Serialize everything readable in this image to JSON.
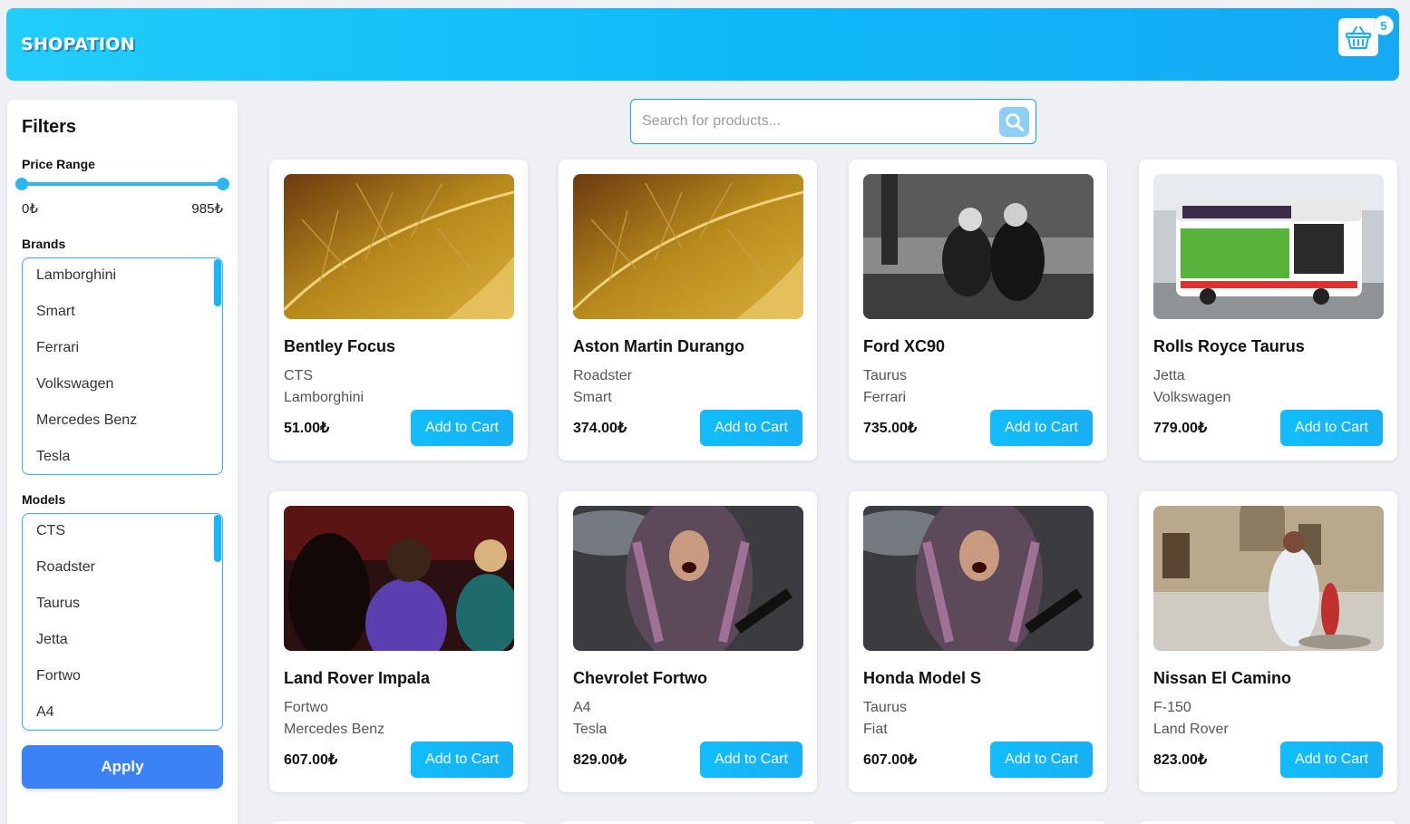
{
  "app": {
    "logo": "SHOPATION"
  },
  "cart": {
    "count": "5",
    "icon": "shopping-basket-icon"
  },
  "search": {
    "placeholder": "Search for products...",
    "icon": "search-icon"
  },
  "sidebar": {
    "title": "Filters",
    "price_range": {
      "label": "Price Range",
      "min_label": "0₺",
      "max_label": "985₺",
      "min": 0,
      "max": 985
    },
    "brands": {
      "label": "Brands",
      "items": [
        "Lamborghini",
        "Smart",
        "Ferrari",
        "Volkswagen",
        "Mercedes Benz",
        "Tesla"
      ]
    },
    "models": {
      "label": "Models",
      "items": [
        "CTS",
        "Roadster",
        "Taurus",
        "Jetta",
        "Fortwo",
        "A4"
      ]
    },
    "apply_label": "Apply"
  },
  "products": [
    {
      "name": "Bentley Focus",
      "model": "CTS",
      "brand": "Lamborghini",
      "price": "51.00₺",
      "button": "Add to Cart"
    },
    {
      "name": "Aston Martin Durango",
      "model": "Roadster",
      "brand": "Smart",
      "price": "374.00₺",
      "button": "Add to Cart"
    },
    {
      "name": "Ford XC90",
      "model": "Taurus",
      "brand": "Ferrari",
      "price": "735.00₺",
      "button": "Add to Cart"
    },
    {
      "name": "Rolls Royce Taurus",
      "model": "Jetta",
      "brand": "Volkswagen",
      "price": "779.00₺",
      "button": "Add to Cart"
    },
    {
      "name": "Land Rover Impala",
      "model": "Fortwo",
      "brand": "Mercedes Benz",
      "price": "607.00₺",
      "button": "Add to Cart"
    },
    {
      "name": "Chevrolet Fortwo",
      "model": "A4",
      "brand": "Tesla",
      "price": "829.00₺",
      "button": "Add to Cart"
    },
    {
      "name": "Honda Model S",
      "model": "Taurus",
      "brand": "Fiat",
      "price": "607.00₺",
      "button": "Add to Cart"
    },
    {
      "name": "Nissan El Camino",
      "model": "F-150",
      "brand": "Land Rover",
      "price": "823.00₺",
      "button": "Add to Cart"
    }
  ],
  "colors": {
    "accent": "#16b4f5",
    "apply": "#3b82f6",
    "header_start": "#22cdfb",
    "header_end": "#16a9f4"
  }
}
